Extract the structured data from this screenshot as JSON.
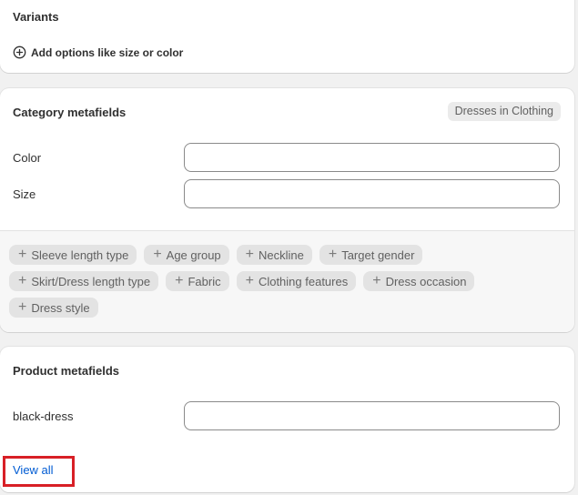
{
  "variants": {
    "title": "Variants",
    "add_options_label": "Add options like size or color"
  },
  "category_metafields": {
    "title": "Category metafields",
    "badge": "Dresses in Clothing",
    "fields": [
      {
        "label": "Color",
        "value": ""
      },
      {
        "label": "Size",
        "value": ""
      }
    ],
    "suggestions": [
      "Sleeve length type",
      "Age group",
      "Neckline",
      "Target gender",
      "Skirt/Dress length type",
      "Fabric",
      "Clothing features",
      "Dress occasion",
      "Dress style"
    ]
  },
  "product_metafields": {
    "title": "Product metafields",
    "fields": [
      {
        "label": "black-dress",
        "value": ""
      }
    ],
    "view_all_label": "View all"
  },
  "colors": {
    "link": "#005bd3",
    "highlight_box": "#d81f26"
  },
  "icons": {
    "add_options": "plus-circle-icon",
    "chip": "plus-icon"
  }
}
